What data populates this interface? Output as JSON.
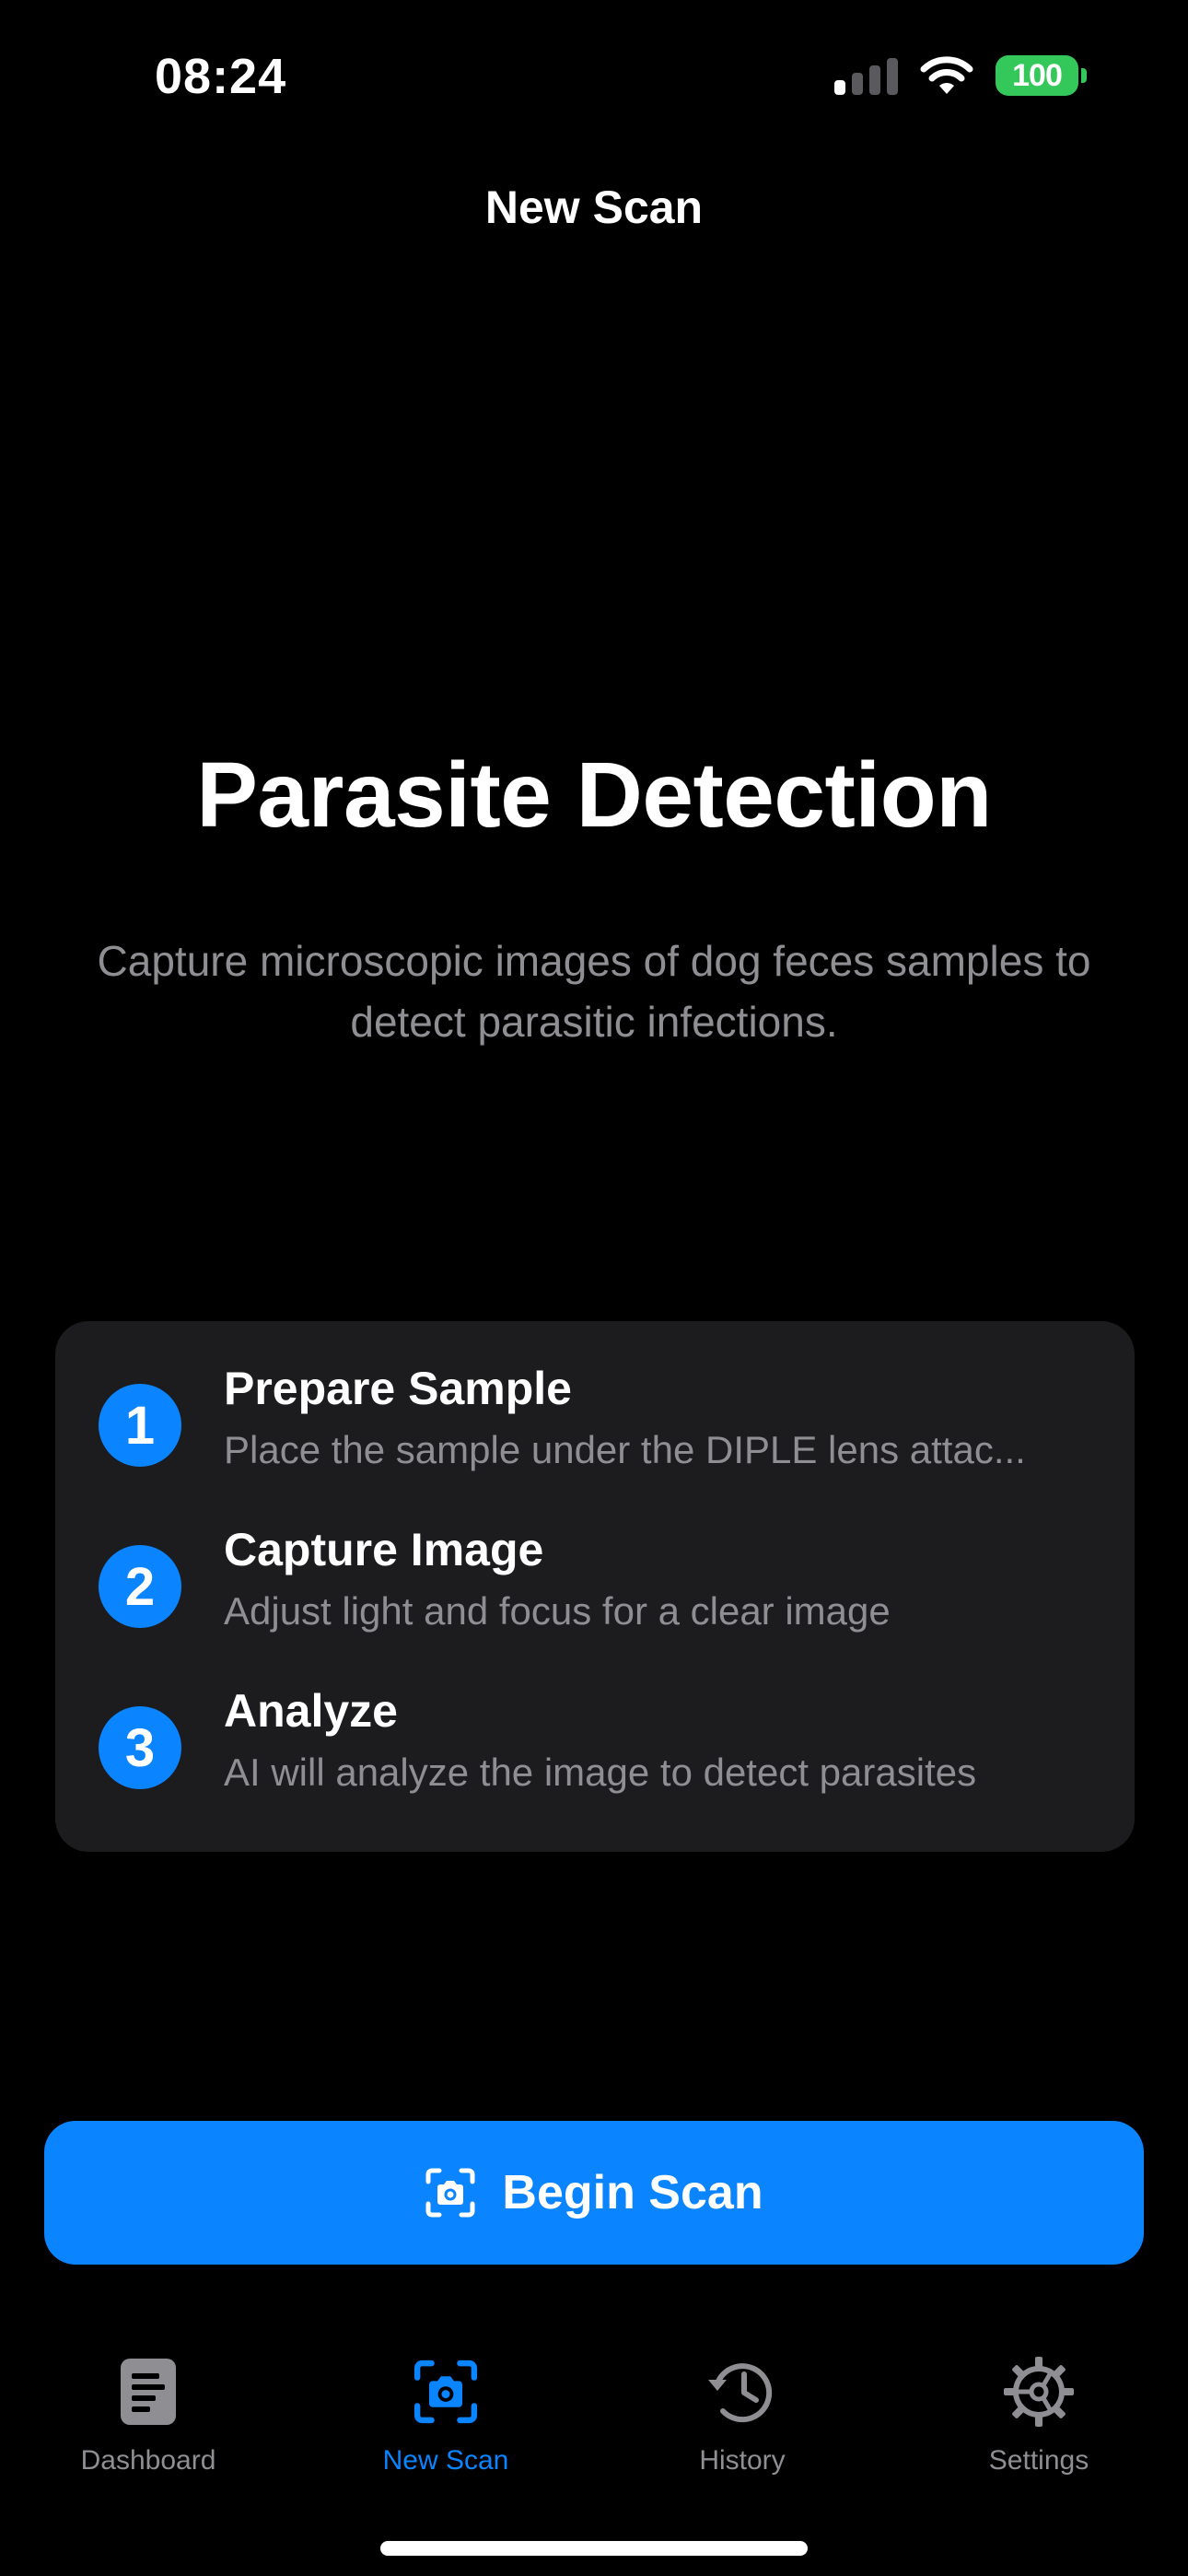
{
  "status_bar": {
    "time": "08:24",
    "battery": "100",
    "signal_bars_active": 1,
    "signal_bars_total": 4,
    "icons": [
      "cellular-signal-icon",
      "wifi-icon",
      "battery-icon"
    ]
  },
  "nav": {
    "title": "New Scan"
  },
  "hero": {
    "title": "Parasite Detection",
    "subtitle": "Capture microscopic images of dog feces samples to detect parasitic infections."
  },
  "steps": [
    {
      "number": "1",
      "title": "Prepare Sample",
      "description": "Place the sample under the DIPLE lens attac..."
    },
    {
      "number": "2",
      "title": "Capture Image",
      "description": "Adjust light and focus for a clear image"
    },
    {
      "number": "3",
      "title": "Analyze",
      "description": "AI will analyze the image to detect parasites"
    }
  ],
  "action": {
    "begin_label": "Begin Scan",
    "icon": "camera-viewfinder-icon"
  },
  "tab_bar": {
    "active": "New Scan",
    "tabs": [
      {
        "label": "Dashboard",
        "icon": "document-icon"
      },
      {
        "label": "New Scan",
        "icon": "camera-viewfinder-icon"
      },
      {
        "label": "History",
        "icon": "history-clock-icon"
      },
      {
        "label": "Settings",
        "icon": "gear-icon"
      }
    ]
  },
  "colors": {
    "background": "#000000",
    "card": "#1c1c1e",
    "accent": "#0a84ff",
    "secondary_text": "#8e8e93",
    "battery": "#34c759"
  }
}
